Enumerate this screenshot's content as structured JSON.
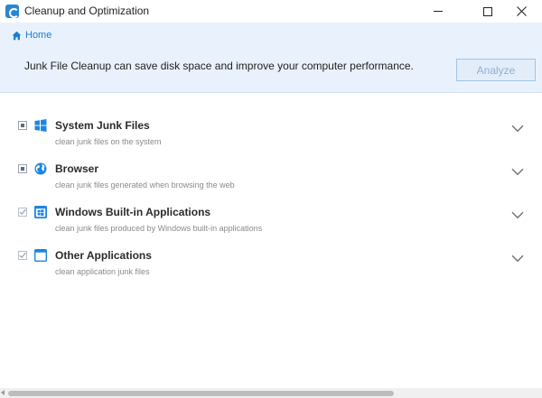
{
  "window": {
    "title": "Cleanup and Optimization"
  },
  "breadcrumb": {
    "home_label": "Home"
  },
  "banner": {
    "message": "Junk File Cleanup can save disk space and improve your computer performance.",
    "analyze_label": "Analyze"
  },
  "categories": [
    {
      "title": "System Junk Files",
      "description": "clean junk files on the system",
      "icon": "windows-logo-icon",
      "check_state": "partial"
    },
    {
      "title": "Browser",
      "description": "clean junk files generated when browsing the web",
      "icon": "globe-icon",
      "check_state": "partial"
    },
    {
      "title": "Windows Built-in Applications",
      "description": "clean junk files produced by Windows built-in applications",
      "icon": "window-app-icon",
      "check_state": "checked"
    },
    {
      "title": "Other Applications",
      "description": "clean application junk files",
      "icon": "application-window-icon",
      "check_state": "checked"
    }
  ],
  "colors": {
    "accent": "#2a86d5",
    "banner_bg": "#e9f1fc"
  }
}
